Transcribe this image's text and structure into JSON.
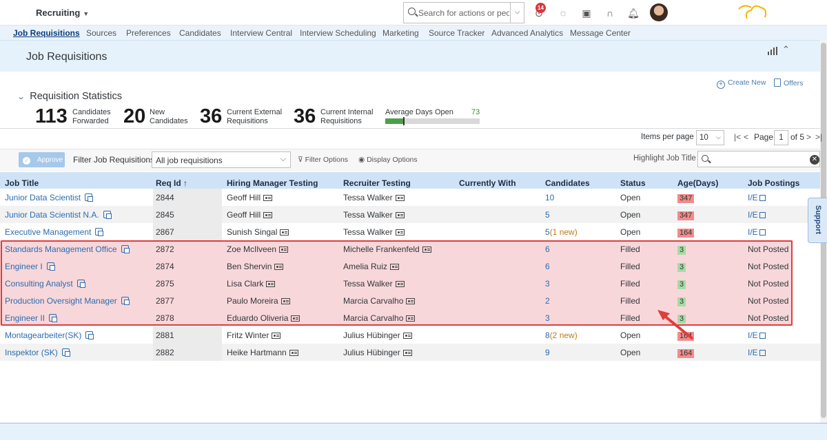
{
  "shell": {
    "app_title": "Recruiting",
    "search_placeholder": "Search for actions or peo...",
    "notification_count": "14"
  },
  "nav": {
    "items": [
      "Job Requisitions",
      "Sources",
      "Preferences",
      "Candidates",
      "Interview Central",
      "Interview Scheduling",
      "Marketing",
      "Source Tracker",
      "Advanced Analytics",
      "Message Center"
    ]
  },
  "page": {
    "title": "Job Requisitions"
  },
  "stats": {
    "heading": "Requisition Statistics",
    "create_new": "Create New",
    "offers": "Offers",
    "items": [
      {
        "value": "113",
        "label1": "Candidates",
        "label2": "Forwarded"
      },
      {
        "value": "20",
        "label1": "New",
        "label2": "Candidates"
      },
      {
        "value": "36",
        "label1": "Current External",
        "label2": "Requisitions"
      },
      {
        "value": "36",
        "label1": "Current Internal",
        "label2": "Requisitions"
      }
    ],
    "avg_label": "Average Days Open",
    "avg_value": "73",
    "avg_fill_fraction": 0.19
  },
  "pagination": {
    "items_per_page_label": "Items per page",
    "items_per_page": "10",
    "page_label": "Page",
    "page": "1",
    "of_label": "of 5"
  },
  "toolbar": {
    "approve": "Approve",
    "filter_label": "Filter Job Requisitions",
    "filter_value": "All job requisitions",
    "filter_options": "Filter Options",
    "display_options": "Display Options",
    "highlight_label": "Highlight Job Title"
  },
  "table": {
    "headers": [
      "Job Title",
      "Req Id",
      "Hiring Manager Testing",
      "Recruiter Testing",
      "Currently With",
      "Candidates",
      "Status",
      "Age(Days)",
      "Job Postings"
    ],
    "sort_indicator": "↑",
    "rows": [
      {
        "title": "Junior Data Scientist",
        "req": "2844",
        "hm": "Geoff Hill",
        "rec": "Tessa Walker",
        "cand": "10",
        "new": "",
        "status": "Open",
        "age": "347",
        "posting": "I/E"
      },
      {
        "title": "Junior Data Scientist N.A.",
        "req": "2845",
        "hm": "Geoff Hill",
        "rec": "Tessa Walker",
        "cand": "5",
        "new": "",
        "status": "Open",
        "age": "347",
        "posting": "I/E"
      },
      {
        "title": "Executive Management",
        "req": "2867",
        "hm": "Sunish Singal",
        "rec": "Tessa Walker",
        "cand": "5",
        "new": "(1 new)",
        "status": "Open",
        "age": "164",
        "posting": "I/E"
      },
      {
        "title": "Standards Management Office",
        "req": "2872",
        "hm": "Zoe McIlveen",
        "rec": "Michelle Frankenfeld",
        "cand": "6",
        "new": "",
        "status": "Filled",
        "age": "3",
        "posting": "Not Posted"
      },
      {
        "title": "Engineer I",
        "req": "2874",
        "hm": "Ben Shervin",
        "rec": "Amelia Ruiz",
        "cand": "6",
        "new": "",
        "status": "Filled",
        "age": "3",
        "posting": "Not Posted"
      },
      {
        "title": "Consulting Analyst",
        "req": "2875",
        "hm": "Lisa Clark",
        "rec": "Tessa Walker",
        "cand": "3",
        "new": "",
        "status": "Filled",
        "age": "3",
        "posting": "Not Posted"
      },
      {
        "title": "Production Oversight Manager",
        "req": "2877",
        "hm": "Paulo Moreira",
        "rec": "Marcia Carvalho",
        "cand": "2",
        "new": "",
        "status": "Filled",
        "age": "3",
        "posting": "Not Posted"
      },
      {
        "title": "Engineer II",
        "req": "2878",
        "hm": "Eduardo Oliveria",
        "rec": "Marcia Carvalho",
        "cand": "3",
        "new": "",
        "status": "Filled",
        "age": "3",
        "posting": "Not Posted"
      },
      {
        "title": "Montagearbeiter(SK)",
        "req": "2881",
        "hm": "Fritz Winter",
        "rec": "Julius Hübinger",
        "cand": "8",
        "new": "(2 new)",
        "status": "Open",
        "age": "164",
        "posting": "I/E"
      },
      {
        "title": "Inspektor (SK)",
        "req": "2882",
        "hm": "Heike Hartmann",
        "rec": "Julius Hübinger",
        "cand": "9",
        "new": "",
        "status": "Open",
        "age": "164",
        "posting": "I/E"
      }
    ]
  },
  "support": "Support",
  "colors": {
    "accent": "#2b6cb0",
    "header_bg": "#cfe3f7",
    "highlight_bg": "#f8d7da",
    "highlight_border": "#e03c3c",
    "age_old": "#f08c8c",
    "age_new": "#a6dba6"
  }
}
